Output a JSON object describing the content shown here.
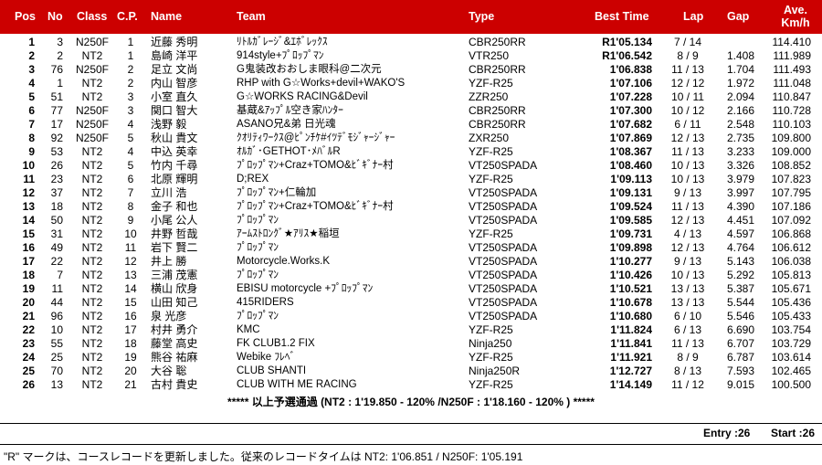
{
  "header": {
    "pos": "Pos",
    "no": "No",
    "class": "Class",
    "cp": "C.P.",
    "name": "Name",
    "team": "Team",
    "type": "Type",
    "best_time": "Best Time",
    "lap": "Lap",
    "gap": "Gap",
    "ave_line1": "Ave.",
    "ave_line2": "Km/h"
  },
  "rows": [
    {
      "pos": "1",
      "no": "3",
      "class": "N250F",
      "cp": "1",
      "name": "近藤 秀明",
      "team": "ﾘﾄﾙｶﾞﾚｰｼﾞ&ｴﾎﾞﾚｯｸｽ",
      "type": "CBR250RR",
      "best": "R1'05.134",
      "lap": "7 / 14",
      "gap": "",
      "ave": "114.410"
    },
    {
      "pos": "2",
      "no": "2",
      "class": "NT2",
      "cp": "1",
      "name": "島崎 洋平",
      "team": "914style+ﾌﾟﾛｯﾌﾟﾏﾝ",
      "type": "VTR250",
      "best": "R1'06.542",
      "lap": "8 / 9",
      "gap": "1.408",
      "ave": "111.989"
    },
    {
      "pos": "3",
      "no": "76",
      "class": "N250F",
      "cp": "2",
      "name": "足立 文尚",
      "team": "G鬼装改おおしま眼科@二次元",
      "type": "CBR250RR",
      "best": "1'06.838",
      "lap": "11 / 13",
      "gap": "1.704",
      "ave": "111.493"
    },
    {
      "pos": "4",
      "no": "1",
      "class": "NT2",
      "cp": "2",
      "name": "内山 智彦",
      "team": "RHP with G☆Works+devil+WAKO'S",
      "type": "YZF-R25",
      "best": "1'07.106",
      "lap": "12 / 12",
      "gap": "1.972",
      "ave": "111.048"
    },
    {
      "pos": "5",
      "no": "51",
      "class": "NT2",
      "cp": "3",
      "name": "小室 直久",
      "team": "G☆WORKS RACING&Devil",
      "type": "ZZR250",
      "best": "1'07.228",
      "lap": "10 / 11",
      "gap": "2.094",
      "ave": "110.847"
    },
    {
      "pos": "6",
      "no": "77",
      "class": "N250F",
      "cp": "3",
      "name": "関口 智大",
      "team": "基蔵&ｱｯﾌﾟﾙ空き家ﾊﾝﾀｰ",
      "type": "CBR250RR",
      "best": "1'07.300",
      "lap": "10 / 12",
      "gap": "2.166",
      "ave": "110.728"
    },
    {
      "pos": "7",
      "no": "17",
      "class": "N250F",
      "cp": "4",
      "name": "浅野 毅",
      "team": "ASANO兄&弟 日光魂",
      "type": "CBR250RR",
      "best": "1'07.682",
      "lap": "6 / 11",
      "gap": "2.548",
      "ave": "110.103"
    },
    {
      "pos": "8",
      "no": "92",
      "class": "N250F",
      "cp": "5",
      "name": "秋山 貴文",
      "team": "ｸｵﾘﾃｨﾜｰｸｽ@ﾋﾟﾝﾁｹ#ｲﾂﾃﾞﾓｼﾞｬｰｼﾞｬｰ",
      "type": "ZXR250",
      "best": "1'07.869",
      "lap": "12 / 13",
      "gap": "2.735",
      "ave": "109.800"
    },
    {
      "pos": "9",
      "no": "53",
      "class": "NT2",
      "cp": "4",
      "name": "中込 英幸",
      "team": "ｵﾙｶﾞ･GETHOT･ﾒﾊﾞﾙR",
      "type": "YZF-R25",
      "best": "1'08.367",
      "lap": "11 / 13",
      "gap": "3.233",
      "ave": "109.000"
    },
    {
      "pos": "10",
      "no": "26",
      "class": "NT2",
      "cp": "5",
      "name": "竹内 千尋",
      "team": "ﾌﾟﾛｯﾌﾟﾏﾝ+Craz+TOMO&ﾋﾞｷﾞﾅｰ村",
      "type": "VT250SPADA",
      "best": "1'08.460",
      "lap": "10 / 13",
      "gap": "3.326",
      "ave": "108.852"
    },
    {
      "pos": "11",
      "no": "23",
      "class": "NT2",
      "cp": "6",
      "name": "北原 輝明",
      "team": "D;REX",
      "type": "YZF-R25",
      "best": "1'09.113",
      "lap": "10 / 13",
      "gap": "3.979",
      "ave": "107.823"
    },
    {
      "pos": "12",
      "no": "37",
      "class": "NT2",
      "cp": "7",
      "name": "立川 浩",
      "team": "ﾌﾟﾛｯﾌﾟﾏﾝ+仁輪加",
      "type": "VT250SPADA",
      "best": "1'09.131",
      "lap": "9 / 13",
      "gap": "3.997",
      "ave": "107.795"
    },
    {
      "pos": "13",
      "no": "18",
      "class": "NT2",
      "cp": "8",
      "name": "金子 和也",
      "team": "ﾌﾟﾛｯﾌﾟﾏﾝ+Craz+TOMO&ﾋﾞｷﾞﾅｰ村",
      "type": "VT250SPADA",
      "best": "1'09.524",
      "lap": "11 / 13",
      "gap": "4.390",
      "ave": "107.186"
    },
    {
      "pos": "14",
      "no": "50",
      "class": "NT2",
      "cp": "9",
      "name": "小尾 公人",
      "team": "ﾌﾟﾛｯﾌﾟﾏﾝ",
      "type": "VT250SPADA",
      "best": "1'09.585",
      "lap": "12 / 13",
      "gap": "4.451",
      "ave": "107.092"
    },
    {
      "pos": "15",
      "no": "31",
      "class": "NT2",
      "cp": "10",
      "name": "井野 哲哉",
      "team": "ｱｰﾑｽﾄﾛﾝｸﾞ★ｱﾘｽ★稲垣",
      "type": "YZF-R25",
      "best": "1'09.731",
      "lap": "4 / 13",
      "gap": "4.597",
      "ave": "106.868"
    },
    {
      "pos": "16",
      "no": "49",
      "class": "NT2",
      "cp": "11",
      "name": "岩下 賢二",
      "team": "ﾌﾟﾛｯﾌﾟﾏﾝ",
      "type": "VT250SPADA",
      "best": "1'09.898",
      "lap": "12 / 13",
      "gap": "4.764",
      "ave": "106.612"
    },
    {
      "pos": "17",
      "no": "22",
      "class": "NT2",
      "cp": "12",
      "name": "井上 勝",
      "team": "Motorcycle.Works.K",
      "type": "VT250SPADA",
      "best": "1'10.277",
      "lap": "9 / 13",
      "gap": "5.143",
      "ave": "106.038"
    },
    {
      "pos": "18",
      "no": "7",
      "class": "NT2",
      "cp": "13",
      "name": "三浦 茂憲",
      "team": "ﾌﾟﾛｯﾌﾟﾏﾝ",
      "type": "VT250SPADA",
      "best": "1'10.426",
      "lap": "10 / 13",
      "gap": "5.292",
      "ave": "105.813"
    },
    {
      "pos": "19",
      "no": "11",
      "class": "NT2",
      "cp": "14",
      "name": "横山 欣身",
      "team": "EBISU motorcycle +ﾌﾟﾛｯﾌﾟﾏﾝ",
      "type": "VT250SPADA",
      "best": "1'10.521",
      "lap": "13 / 13",
      "gap": "5.387",
      "ave": "105.671"
    },
    {
      "pos": "20",
      "no": "44",
      "class": "NT2",
      "cp": "15",
      "name": "山田 知己",
      "team": "415RIDERS",
      "type": "VT250SPADA",
      "best": "1'10.678",
      "lap": "13 / 13",
      "gap": "5.544",
      "ave": "105.436"
    },
    {
      "pos": "21",
      "no": "96",
      "class": "NT2",
      "cp": "16",
      "name": "泉 光彦",
      "team": "ﾌﾟﾛｯﾌﾟﾏﾝ",
      "type": "VT250SPADA",
      "best": "1'10.680",
      "lap": "6 / 10",
      "gap": "5.546",
      "ave": "105.433"
    },
    {
      "pos": "22",
      "no": "10",
      "class": "NT2",
      "cp": "17",
      "name": "村井 勇介",
      "team": "KMC",
      "type": "YZF-R25",
      "best": "1'11.824",
      "lap": "6 / 13",
      "gap": "6.690",
      "ave": "103.754"
    },
    {
      "pos": "23",
      "no": "55",
      "class": "NT2",
      "cp": "18",
      "name": "藤堂 高史",
      "team": "FK CLUB1.2 FIX",
      "type": "Ninja250",
      "best": "1'11.841",
      "lap": "11 / 13",
      "gap": "6.707",
      "ave": "103.729"
    },
    {
      "pos": "24",
      "no": "25",
      "class": "NT2",
      "cp": "19",
      "name": "熊谷 祐麻",
      "team": "Webike ﾌﾚﾍﾞ",
      "type": "YZF-R25",
      "best": "1'11.921",
      "lap": "8 / 9",
      "gap": "6.787",
      "ave": "103.614"
    },
    {
      "pos": "25",
      "no": "70",
      "class": "NT2",
      "cp": "20",
      "name": "大谷 聡",
      "team": "CLUB SHANTI",
      "type": "Ninja250R",
      "best": "1'12.727",
      "lap": "8 / 13",
      "gap": "7.593",
      "ave": "102.465"
    },
    {
      "pos": "26",
      "no": "13",
      "class": "NT2",
      "cp": "21",
      "name": "古村 貴史",
      "team": "CLUB WITH ME RACING",
      "type": "YZF-R25",
      "best": "1'14.149",
      "lap": "11 / 12",
      "gap": "9.015",
      "ave": "100.500"
    }
  ],
  "qualify_note": "***** 以上予選通過 (NT2 : 1'19.850 - 120% /N250F : 1'18.160 - 120% ) *****",
  "entry": "Entry :26",
  "start": "Start :26",
  "footer_note": "\"R\" マークは、コースレコードを更新しました。従来のレコードタイムは NT2: 1'06.851 / N250F: 1'05.191",
  "colors": {
    "header_bg": "#cc0000",
    "header_text": "#ffffff"
  }
}
